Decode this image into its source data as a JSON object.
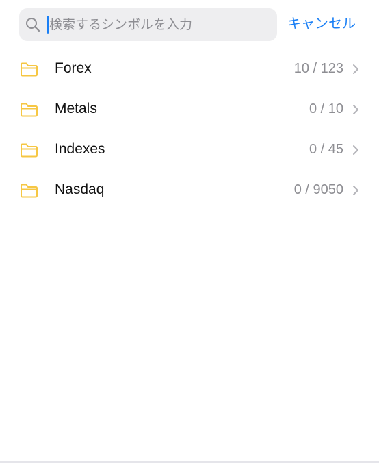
{
  "search": {
    "placeholder": "検索するシンボルを入力",
    "value": ""
  },
  "cancel_label": "キャンセル",
  "accent_color": "#1a7ff5",
  "folder_color": "#f6c744",
  "folders": [
    {
      "label": "Forex",
      "count": "10 / 123",
      "icon": "folder-icon"
    },
    {
      "label": "Metals",
      "count": "0 / 10",
      "icon": "folder-icon"
    },
    {
      "label": "Indexes",
      "count": "0 / 45",
      "icon": "folder-icon"
    },
    {
      "label": "Nasdaq",
      "count": "0 / 9050",
      "icon": "folder-icon"
    }
  ]
}
